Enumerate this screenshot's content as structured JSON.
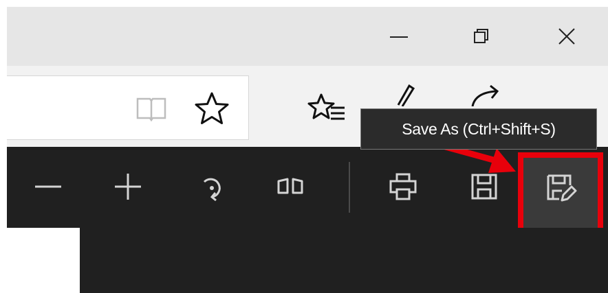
{
  "window_controls": {
    "minimize": "minimize-icon",
    "restore": "restore-icon",
    "close": "close-icon"
  },
  "toolbar": {
    "reading_view": "book-icon",
    "favorite": "star-icon",
    "favorites_hub": "favorites-list-icon",
    "web_note": "pen-icon",
    "share": "share-icon"
  },
  "pdf_toolbar": {
    "icons": [
      "zoom-out-icon",
      "zoom-in-icon",
      "rotate-icon",
      "two-page-icon",
      "print-icon",
      "save-icon",
      "save-as-icon"
    ]
  },
  "tooltip": {
    "text": "Save As (Ctrl+Shift+S)"
  },
  "colors": {
    "title_bar": "#e6e6e6",
    "toolbar": "#f2f2f2",
    "pdf_toolbar": "#202020",
    "highlight": "#e8000b",
    "arrow": "#e8000b"
  }
}
